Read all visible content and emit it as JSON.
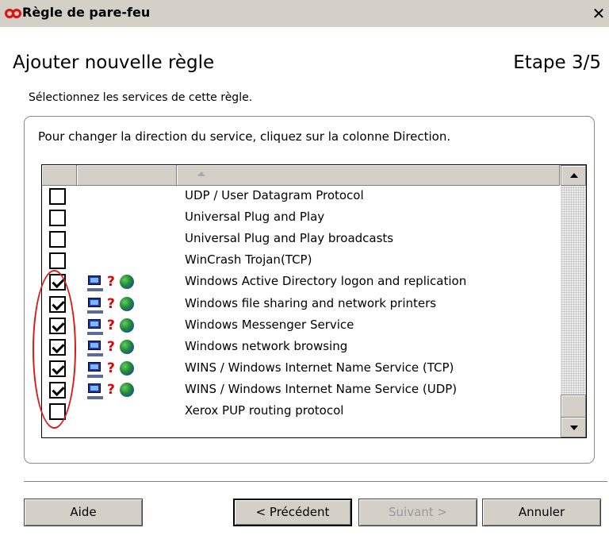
{
  "window": {
    "title": "Règle de pare-feu",
    "close_glyph": "✕",
    "logo_icon": "infinity-logo-icon"
  },
  "header": {
    "title": "Ajouter nouvelle règle",
    "step": "Etape 3/5",
    "subtitle": "Sélectionnez les services de cette règle."
  },
  "group": {
    "instruction": "Pour changer la direction du service, cliquez sur la colonne Direction."
  },
  "services": [
    {
      "label": "UDP / User Datagram Protocol",
      "checked": false,
      "icons": false
    },
    {
      "label": "Universal Plug and Play",
      "checked": false,
      "icons": false
    },
    {
      "label": "Universal Plug and Play broadcasts",
      "checked": false,
      "icons": false
    },
    {
      "label": "WinCrash Trojan(TCP)",
      "checked": false,
      "icons": false
    },
    {
      "label": "Windows Active Directory logon and replication",
      "checked": true,
      "icons": true
    },
    {
      "label": "Windows file sharing and network printers",
      "checked": true,
      "icons": true
    },
    {
      "label": "Windows Messenger Service",
      "checked": true,
      "icons": true
    },
    {
      "label": "Windows network browsing",
      "checked": true,
      "icons": true
    },
    {
      "label": "WINS / Windows Internet Name Service (TCP)",
      "checked": true,
      "icons": true
    },
    {
      "label": "WINS / Windows Internet Name Service (UDP)",
      "checked": true,
      "icons": true
    },
    {
      "label": "Xerox PUP routing protocol",
      "checked": false,
      "icons": false
    }
  ],
  "direction_icons": {
    "computer": "computer-icon",
    "question": "?",
    "globe": "globe-icon"
  },
  "buttons": {
    "help": "Aide",
    "previous": "< Précédent",
    "next": "Suivant >",
    "cancel": "Annuler"
  },
  "colors": {
    "titlebar_bg": "#d4d0c8",
    "highlight_circle": "#e01818",
    "question_mark": "#e00000",
    "disabled_text": "#9a9a9a"
  }
}
